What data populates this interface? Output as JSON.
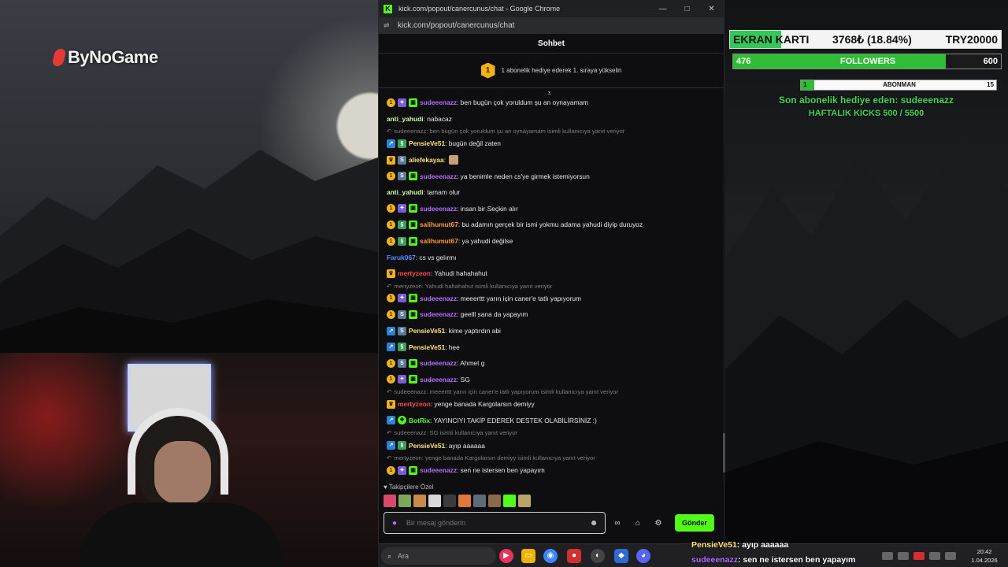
{
  "overlay_left": {
    "logo": "ByNoGame"
  },
  "window": {
    "title": "kick.com/popout/canercunus/chat - Google Chrome",
    "url": "kick.com/popout/canercunus/chat",
    "minimize": "—",
    "maximize": "□",
    "close": "✕"
  },
  "chat": {
    "header": "Sohbet",
    "pinned_badge": "1",
    "pinned_text": "1 abonelik hediye ederek 1. sıraya yükselin",
    "follower_only_label": "♥ Takipçilere Özel",
    "input_placeholder": "Bir mesaj gönderin",
    "send_label": "Gönder",
    "messages": [
      {
        "type": "msg",
        "badges": [
          "coin",
          "sub",
          "gift"
        ],
        "user": "sudeeenazz",
        "color": "#b76cff",
        "text": ": ben bugün çok yoruldum şu an oynayamam"
      },
      {
        "type": "msg",
        "badges": [],
        "user": "anti_yahudi",
        "color": "#c8ff9c",
        "text": ": nabacaz"
      },
      {
        "type": "reply",
        "text": "sudeeenazz: ben bugün çok yoruldum şu an oynayamam isimli kullanıcıya yanıt veriyor"
      },
      {
        "type": "msg",
        "badges": [
          "arrow",
          "gs"
        ],
        "user": "PensieVe51",
        "color": "#ffe37a",
        "text": ": bugün değil zaten"
      },
      {
        "type": "msg",
        "badges": [
          "crown",
          "sub2"
        ],
        "user": "aliefekayaa",
        "color": "#ffe37a",
        "text": ":",
        "emote": true
      },
      {
        "type": "msg",
        "badges": [
          "coin",
          "sub2",
          "gift"
        ],
        "user": "sudeeenazz",
        "color": "#b76cff",
        "text": ": ya benimle neden cs'ye girmek istemiyorsun"
      },
      {
        "type": "msg",
        "badges": [],
        "user": "anti_yahudi",
        "color": "#c8ff9c",
        "text": ": tamam olur"
      },
      {
        "type": "msg",
        "badges": [
          "coin",
          "sub",
          "gift"
        ],
        "user": "sudeeenazz",
        "color": "#b76cff",
        "text": ": insan bir Seçkin alır"
      },
      {
        "type": "msg",
        "badges": [
          "coin",
          "gs",
          "gift"
        ],
        "user": "salihumut67",
        "color": "#ff9a3c",
        "text": ": bu adamın gerçek bir ismi yokmu adama yahudi diyip duruyoz"
      },
      {
        "type": "msg",
        "badges": [
          "coin",
          "gs",
          "gift"
        ],
        "user": "salihumut67",
        "color": "#ff9a3c",
        "text": ": ya yahudi değilse"
      },
      {
        "type": "msg",
        "badges": [],
        "user": "Faruk067",
        "color": "#5b8cff",
        "text": ": cs vs gelırmı"
      },
      {
        "type": "msg",
        "badges": [
          "crown"
        ],
        "user": "mertyzeon",
        "color": "#ff4a4a",
        "text": ": Yahudi hahahahut"
      },
      {
        "type": "reply",
        "text": "mertyzeon: Yahudi hahahahut isimli kullanıcıya yanıt veriyor"
      },
      {
        "type": "msg",
        "badges": [
          "coin",
          "sub",
          "gift"
        ],
        "user": "sudeeenazz",
        "color": "#b76cff",
        "text": ": meeerttt yarın için caner'e tatlı yapıyorum"
      },
      {
        "type": "msg",
        "badges": [
          "coin",
          "sub2",
          "gift"
        ],
        "user": "sudeeenazz",
        "color": "#b76cff",
        "text": ": geelll sana da yapayım"
      },
      {
        "type": "msg",
        "badges": [
          "arrow",
          "sub2"
        ],
        "user": "PensieVe51",
        "color": "#ffe37a",
        "text": ": kime yaptırdın abi"
      },
      {
        "type": "msg",
        "badges": [
          "arrow",
          "gs"
        ],
        "user": "PensieVe51",
        "color": "#ffe37a",
        "text": ": hee"
      },
      {
        "type": "msg",
        "badges": [
          "coin",
          "sub2",
          "gift"
        ],
        "user": "sudeeenazz",
        "color": "#b76cff",
        "text": ": Ahmet g"
      },
      {
        "type": "msg",
        "badges": [
          "coin",
          "sub",
          "gift"
        ],
        "user": "sudeeenazz",
        "color": "#b76cff",
        "text": ": SG"
      },
      {
        "type": "reply",
        "text": "sudeeenazz: meeerttt yarın için caner'e tatlı yapıyorum isimli kullanıcıya yanıt veriyor"
      },
      {
        "type": "msg",
        "badges": [
          "crown"
        ],
        "user": "mertyzeon",
        "color": "#ff4a4a",
        "text": ": yenge banada Kargolarsın demiyy"
      },
      {
        "type": "msg",
        "badges": [
          "arrow",
          "bot"
        ],
        "user": "BotRix",
        "color": "#53fc18",
        "text": ": YAYINCIYI TAKİP EDEREK DESTEK OLABİLİRSİNİZ :)"
      },
      {
        "type": "reply",
        "text": "sudeeenazz: SG isimli kullanıcıya yanıt veriyor"
      },
      {
        "type": "msg",
        "badges": [
          "arrow",
          "gs"
        ],
        "user": "PensieVe51",
        "color": "#ffe37a",
        "text": ": ayıp aaaaaa"
      },
      {
        "type": "reply",
        "text": "mertyzeon: yenge banada Kargolarsın demiyy isimli kullanıcıya yanıt veriyor"
      },
      {
        "type": "msg",
        "badges": [
          "coin",
          "sub",
          "gift"
        ],
        "user": "sudeeenazz",
        "color": "#b76cff",
        "text": ": sen ne istersen ben yapayım"
      }
    ]
  },
  "overlay_right": {
    "gpu_label": "EKRAN KARTI",
    "gpu_amount": "3768₺ (18.84%)",
    "gpu_goal": "TRY20000",
    "gpu_progress": 0.1884,
    "followers_current": "476",
    "followers_label": "FOLLOWERS",
    "followers_goal": "600",
    "followers_progress": 0.793,
    "sub_current": "1",
    "sub_label": "ABONMAN",
    "sub_goal": "15",
    "sub_progress": 0.067,
    "last_gifter": "Son abonelik hediye eden: sudeeenazz",
    "weekly": "HAFTALIK KICKS 500 / 5500"
  },
  "overlay_chat": [
    {
      "user": "PensieVe51",
      "color": "#ffe37a",
      "text": " : ayıp aaaaaa"
    },
    {
      "user": "sudeeenazz",
      "color": "#b76cff",
      "text": " : sen ne istersen ben yapayım"
    }
  ],
  "taskbar": {
    "search_placeholder": "Ara",
    "time": "20:42",
    "date": "1.04.2026"
  },
  "colors": {
    "kick_green": "#53fc18",
    "panel": "#0e0e10"
  }
}
